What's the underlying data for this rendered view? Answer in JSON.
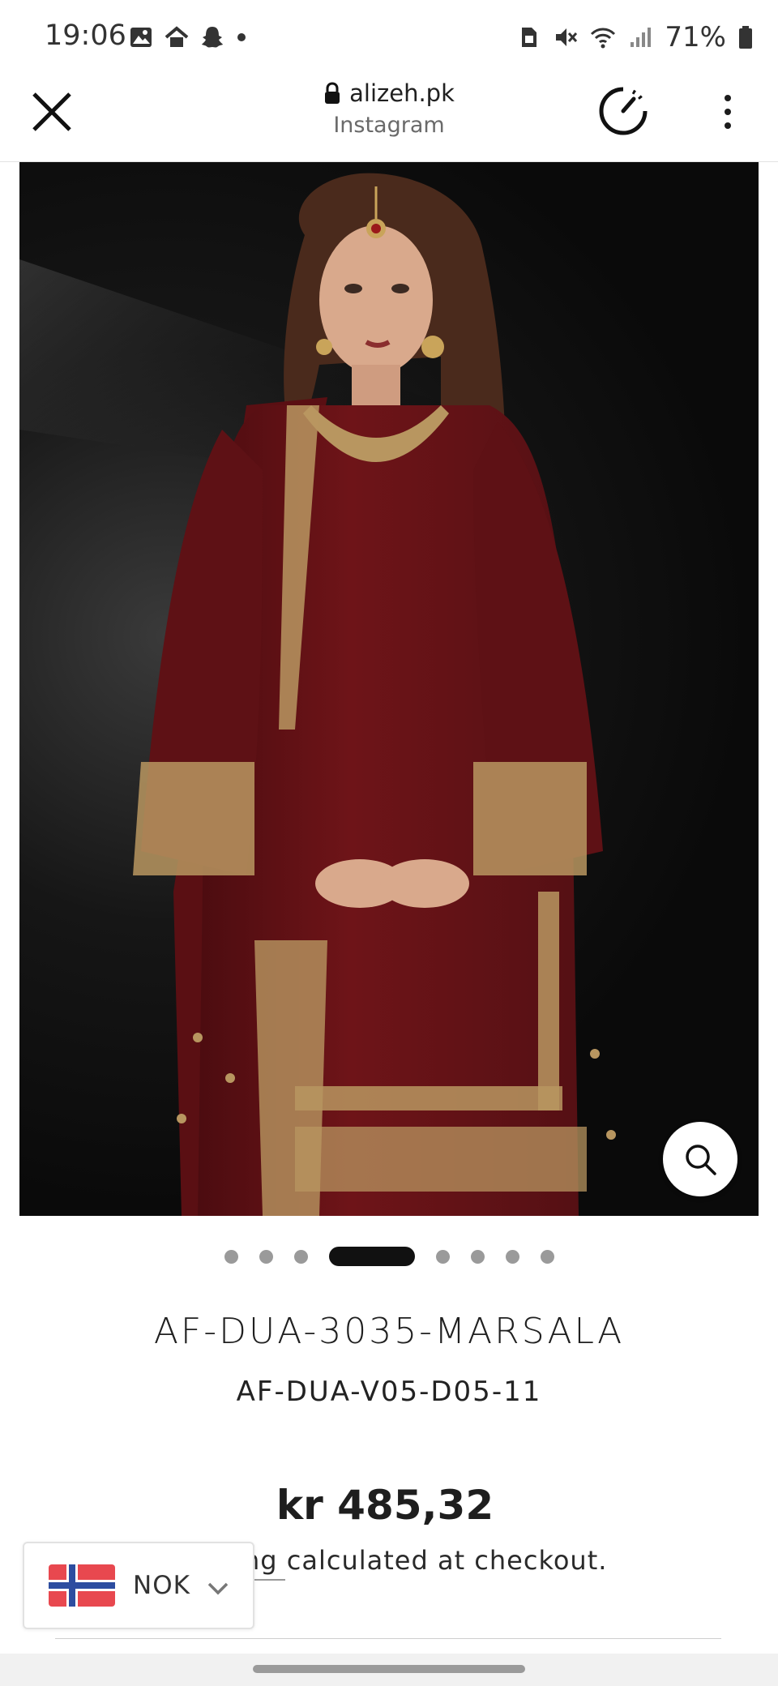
{
  "status_bar": {
    "time": "19:06",
    "battery": "71%",
    "left_icons": [
      "image-icon",
      "home-roof-icon",
      "snapchat-ghost-icon",
      "dot-icon"
    ],
    "right_icons": [
      "sim-icon",
      "mute-icon",
      "wifi-icon",
      "signal-icon",
      "battery-icon"
    ]
  },
  "browser": {
    "domain": "alizeh.pk",
    "subtitle": "Instagram"
  },
  "carousel": {
    "dot_count": 8,
    "active_index": 3
  },
  "product": {
    "title": "AF-DUA-3035-MARSALA",
    "sku": "AF-DUA-V05-D05-11",
    "price": "kr 485,32",
    "shipping_visible_text": "ng calculated at checkout."
  },
  "currency_selector": {
    "code": "NOK",
    "flag": "norway-flag-icon"
  },
  "colors": {
    "dress": "#6e1418",
    "embroidery": "#b89660",
    "background_dark": "#0c0c0c",
    "active_dot": "#111111"
  }
}
